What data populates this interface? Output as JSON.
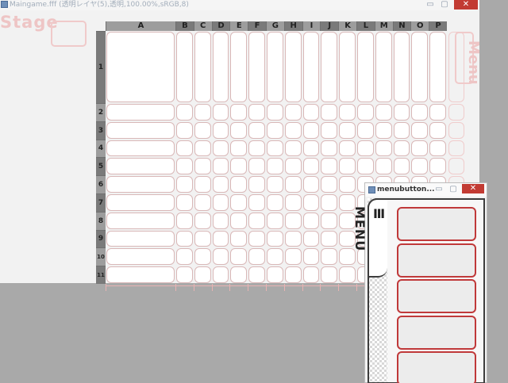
{
  "main_window": {
    "title": "Maingame.fff (透明レイヤ(5),透明,100.00%,sRGB,8)",
    "controls": {
      "minimize": "▭",
      "maximize": "▢",
      "close": "✕"
    }
  },
  "stage": {
    "label": "Stage"
  },
  "menu_tab": {
    "label": "Menu"
  },
  "columns": [
    "A",
    "B",
    "C",
    "D",
    "E",
    "F",
    "G",
    "H",
    "I",
    "J",
    "K",
    "L",
    "M",
    "N",
    "O",
    "P"
  ],
  "rows": [
    "1",
    "2",
    "3",
    "4",
    "5",
    "6",
    "7",
    "8",
    "9",
    "10",
    "11"
  ],
  "highlighted_columns": [
    "B",
    "D",
    "F",
    "H",
    "J",
    "L",
    "N",
    "P"
  ],
  "highlighted_rows": [
    "1",
    "3",
    "5",
    "7",
    "9",
    "11"
  ],
  "sub_window": {
    "title": "menubutton...",
    "controls": {
      "minimize": "▭",
      "maximize": "▢",
      "close": "✕"
    },
    "menu_label": "Ⅲ MENU",
    "button_count": 5
  },
  "colors": {
    "accent_red": "#c0393a",
    "ghost_pink": "#eec5c5",
    "header_gray": "#9d9d9d",
    "close_red": "#c23b33"
  }
}
